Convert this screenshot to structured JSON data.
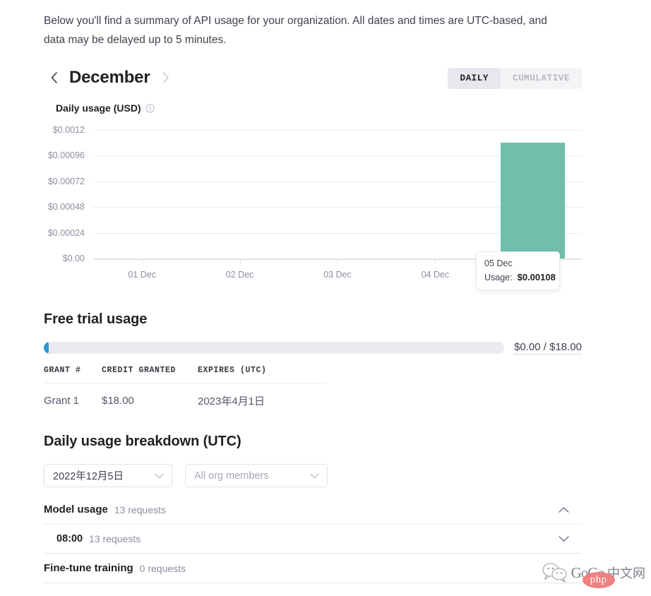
{
  "intro": {
    "text": "Below you'll find a summary of API usage for your organization. All dates and times are UTC-based, and data may be delayed up to 5 minutes."
  },
  "chart_header": {
    "month": "December",
    "prev_icon": "chevron-left-icon",
    "next_icon": "chevron-right-icon",
    "tabs": [
      {
        "label": "DAILY",
        "active": true
      },
      {
        "label": "CUMULATIVE",
        "active": false
      }
    ],
    "chart_title": "Daily usage (USD)",
    "info_icon": "info-circle-icon"
  },
  "chart_data": {
    "type": "bar",
    "title": "Daily usage (USD)",
    "xlabel": "",
    "ylabel": "",
    "categories": [
      "01 Dec",
      "02 Dec",
      "03 Dec",
      "04 Dec",
      "05 Dec"
    ],
    "values": [
      0,
      0,
      0,
      0,
      0.00108
    ],
    "ylim": [
      0,
      0.0012
    ],
    "yticks": [
      0,
      0.00024,
      0.00048,
      0.00072,
      0.00096,
      0.0012
    ],
    "ytick_labels": [
      "$0.00",
      "$0.00024",
      "$0.00048",
      "$0.00072",
      "$0.00096",
      "$0.0012"
    ],
    "grid": true,
    "legend": false,
    "bar_color": "#70bfaa",
    "tooltip": {
      "date": "05 Dec",
      "label": "Usage:",
      "value": "$0.00108"
    }
  },
  "free_trial": {
    "title": "Free trial usage",
    "progress_percent": 0,
    "amount_used": "$0.00",
    "amount_total": "$18.00",
    "amount_display": "$0.00 / $18.00",
    "fill_color": "#2d95d2",
    "track_color": "#eaeaf0",
    "table": {
      "headers": [
        "GRANT #",
        "CREDIT GRANTED",
        "EXPIRES (UTC)"
      ],
      "rows": [
        [
          "Grant 1",
          "$18.00",
          "2023年4月1日"
        ]
      ]
    }
  },
  "breakdown": {
    "title": "Daily usage breakdown (UTC)",
    "date_select": {
      "value": "2022年12月5日",
      "caret_icon": "chevron-down-icon"
    },
    "member_select": {
      "value": "",
      "placeholder": "All org members",
      "caret_icon": "chevron-down-icon"
    },
    "rows": [
      {
        "label": "Model usage",
        "count": "13 requests",
        "chevron": "chevron-up-icon",
        "expanded": true,
        "children": [
          {
            "label": "08:00",
            "count": "13 requests",
            "chevron": "chevron-down-icon"
          }
        ]
      },
      {
        "label": "Fine-tune training",
        "count": "0 requests",
        "chevron": "",
        "expanded": false,
        "children": []
      }
    ]
  },
  "watermark": {
    "icon": "wechat-icon",
    "text": "GoGo",
    "cn_text": "中文网",
    "badge": "php",
    "badge_color": "#ec6a6a"
  }
}
